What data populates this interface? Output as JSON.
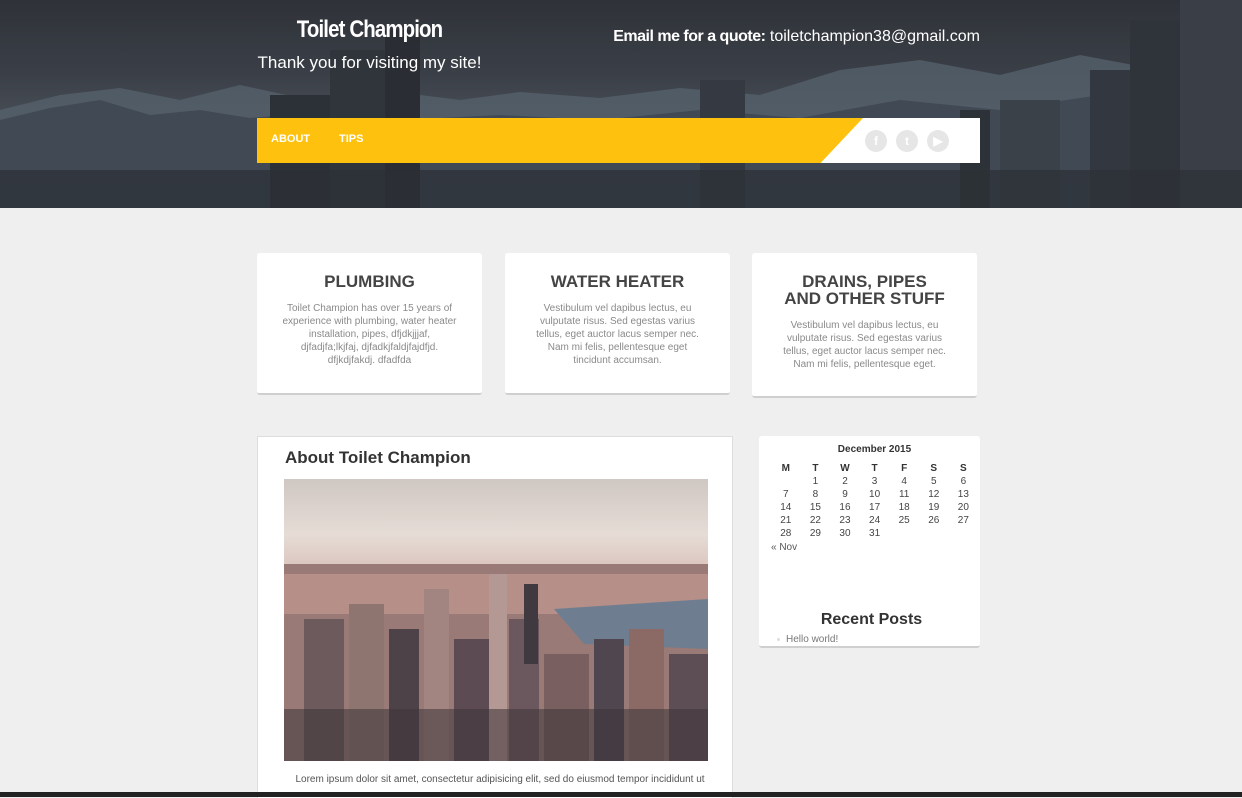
{
  "header": {
    "site_title": "Toilet Champion",
    "tagline": "Thank you for visiting my site!",
    "quote_label": "Email me for a quote:",
    "quote_email": "toiletchampion38@gmail.com"
  },
  "nav": {
    "items": [
      {
        "label": "ABOUT"
      },
      {
        "label": "TIPS"
      }
    ],
    "social": [
      {
        "icon": "facebook-icon",
        "glyph": "f"
      },
      {
        "icon": "twitter-icon",
        "glyph": "t"
      },
      {
        "icon": "youtube-icon",
        "glyph": "▶"
      }
    ]
  },
  "cards": [
    {
      "title": "PLUMBING",
      "body": "Toilet Champion has over 15 years of experience with plumbing, water heater installation, pipes, dfjdkjjjaf, djfadjfa;lkjfaj, djfadkjfaldjfajdfjd. dfjkdjfakdj. dfadfda"
    },
    {
      "title": "WATER HEATER",
      "body": "Vestibulum vel dapibus lectus, eu vulputate risus. Sed egestas varius tellus, eget auctor lacus semper nec. Nam mi felis, pellentesque eget tincidunt accumsan."
    },
    {
      "title": "DRAINS, PIPES AND OTHER STUFF",
      "body": "Vestibulum vel dapibus lectus, eu vulputate risus. Sed egestas varius tellus, eget auctor lacus semper nec. Nam mi felis, pellentesque eget."
    }
  ],
  "article": {
    "title": "About Toilet Champion",
    "excerpt": "Lorem ipsum dolor sit amet, consectetur adipisicing elit, sed do eiusmod tempor incididunt ut"
  },
  "calendar": {
    "caption": "December 2015",
    "weekdays": [
      "M",
      "T",
      "W",
      "T",
      "F",
      "S",
      "S"
    ],
    "weeks": [
      [
        "",
        "1",
        "2",
        "3",
        "4",
        "5",
        "6"
      ],
      [
        "7",
        "8",
        "9",
        "10",
        "11",
        "12",
        "13"
      ],
      [
        "14",
        "15",
        "16",
        "17",
        "18",
        "19",
        "20"
      ],
      [
        "21",
        "22",
        "23",
        "24",
        "25",
        "26",
        "27"
      ],
      [
        "28",
        "29",
        "30",
        "31",
        "",
        "",
        ""
      ]
    ],
    "prev_link": "« Nov"
  },
  "recent_posts": {
    "title": "Recent Posts",
    "items": [
      "Hello world!"
    ]
  },
  "colors": {
    "nav_accent": "#fec10e",
    "page_background": "#efefef"
  }
}
